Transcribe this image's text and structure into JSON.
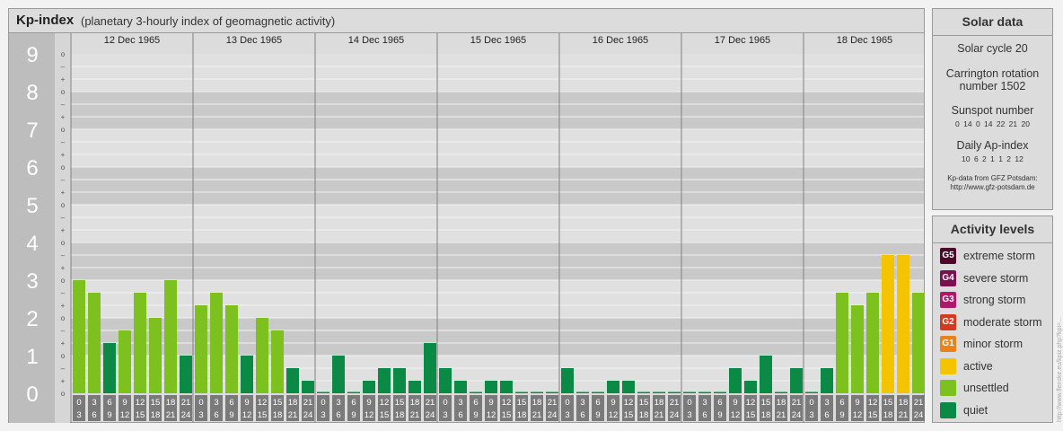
{
  "title": "Kp-index",
  "subtitle": "(planetary 3-hourly index of geomagnetic activity)",
  "chart_data": {
    "type": "bar",
    "ylim": [
      0,
      9
    ],
    "y_ticks": [
      "0",
      "1",
      "2",
      "3",
      "4",
      "5",
      "6",
      "7",
      "8",
      "9"
    ],
    "minor_tick_labels": [
      "o",
      "+",
      "–",
      "o",
      "+",
      "–",
      "o",
      "+",
      "–",
      "o",
      "+",
      "–",
      "o",
      "+",
      "–",
      "o",
      "+",
      "–",
      "o",
      "+",
      "–",
      "o",
      "+",
      "–",
      "o",
      "+",
      "–",
      "o"
    ],
    "days": [
      "12 Dec 1965",
      "13 Dec 1965",
      "14 Dec 1965",
      "15 Dec 1965",
      "16 Dec 1965",
      "17 Dec 1965",
      "18 Dec 1965"
    ],
    "interval_labels_top": [
      "0",
      "3",
      "6",
      "9",
      "12",
      "15",
      "18",
      "21"
    ],
    "interval_labels_bottom": [
      "3",
      "6",
      "9",
      "12",
      "15",
      "18",
      "21",
      "24"
    ],
    "series": [
      {
        "day": "12 Dec 1965",
        "values": [
          3.0,
          2.667,
          1.333,
          1.667,
          2.667,
          2.0,
          3.0,
          1.0
        ]
      },
      {
        "day": "13 Dec 1965",
        "values": [
          2.333,
          2.667,
          2.333,
          1.0,
          2.0,
          1.667,
          0.667,
          0.333
        ]
      },
      {
        "day": "14 Dec 1965",
        "values": [
          0,
          1.0,
          0,
          0.333,
          0.667,
          0.667,
          0.333,
          1.333
        ]
      },
      {
        "day": "15 Dec 1965",
        "values": [
          0.667,
          0.333,
          0,
          0.333,
          0.333,
          0,
          0,
          0
        ]
      },
      {
        "day": "16 Dec 1965",
        "values": [
          0.667,
          0,
          0,
          0.333,
          0.333,
          0,
          0,
          0
        ]
      },
      {
        "day": "17 Dec 1965",
        "values": [
          0,
          0,
          0,
          0.667,
          0.333,
          1.0,
          0,
          0.667
        ]
      },
      {
        "day": "18 Dec 1965",
        "values": [
          0,
          0.667,
          2.667,
          2.333,
          2.667,
          3.667,
          3.667,
          2.667
        ]
      }
    ],
    "level_colors": {
      "quiet": "#0a8a45",
      "unsettled": "#7dc11f",
      "active": "#f5c400"
    }
  },
  "solar": {
    "heading": "Solar data",
    "cycle": "Solar cycle 20",
    "carrington_line1": "Carrington rotation",
    "carrington_line2": "number 1502",
    "sunspot_label": "Sunspot number",
    "sunspot_values": "0  14  0  14  22  21  20",
    "ap_label": "Daily Ap-index",
    "ap_values": "10  6  2  1  1  2  12",
    "credit_line1": "Kp-data from GFZ Potsdam:",
    "credit_line2": "http://www.gfz-potsdam.de"
  },
  "activity": {
    "heading": "Activity levels",
    "levels": [
      {
        "badge": "G5",
        "label": "extreme storm",
        "color": "#4a0a2a"
      },
      {
        "badge": "G4",
        "label": "severe storm",
        "color": "#7a1050"
      },
      {
        "badge": "G3",
        "label": "strong storm",
        "color": "#b0186a"
      },
      {
        "badge": "G2",
        "label": "moderate storm",
        "color": "#d63a1e"
      },
      {
        "badge": "G1",
        "label": "minor storm",
        "color": "#e8821c"
      },
      {
        "badge": "",
        "label": "active",
        "color": "#f5c400"
      },
      {
        "badge": "",
        "label": "unsettled",
        "color": "#7dc11f"
      },
      {
        "badge": "",
        "label": "quiet",
        "color": "#0a8a45"
      }
    ]
  },
  "watermark": "http://www.flenske.eu/kpiz.php?kpi=..."
}
